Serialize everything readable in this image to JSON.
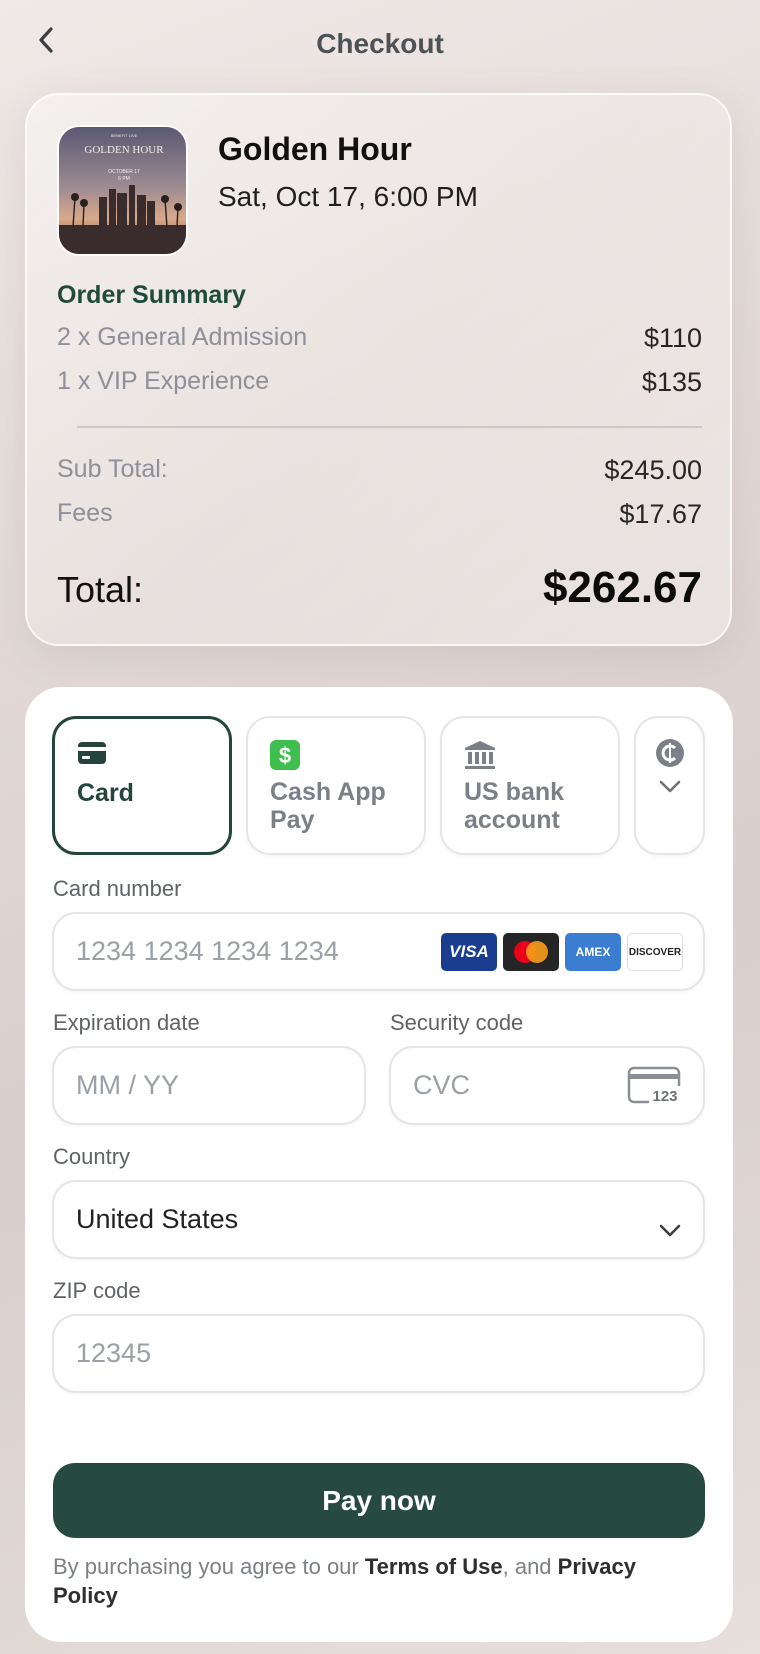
{
  "header": {
    "title": "Checkout"
  },
  "event": {
    "title": "Golden Hour",
    "datetime": "Sat, Oct 17, 6:00 PM",
    "thumbnail_text": {
      "top": "BENEFIT LIVE",
      "title": "GOLDEN HOUR",
      "date": "OCTOBER 17",
      "time": "6 PM"
    }
  },
  "order": {
    "heading": "Order Summary",
    "items": [
      {
        "label": "2 x General Admission",
        "price": "$110"
      },
      {
        "label": "1 x VIP Experience",
        "price": "$135"
      }
    ],
    "subtotal_label": "Sub Total:",
    "subtotal_value": "$245.00",
    "fees_label": "Fees",
    "fees_value": "$17.67",
    "total_label": "Total:",
    "total_value": "$262.67"
  },
  "payment": {
    "methods": [
      {
        "label": "Card",
        "icon": "credit-card-icon",
        "selected": true
      },
      {
        "label_line1": "Cash App",
        "label_line2": "Pay",
        "icon": "cash-app-icon"
      },
      {
        "label_line1": "US bank",
        "label_line2": "account",
        "icon": "bank-icon"
      },
      {
        "icon": "crypto-coin-icon"
      }
    ],
    "card_number": {
      "label": "Card number",
      "placeholder": "1234 1234 1234 1234"
    },
    "brands": [
      "VISA",
      "Mastercard",
      "AMEX",
      "DISCOVER"
    ],
    "expiration": {
      "label": "Expiration date",
      "placeholder": "MM / YY"
    },
    "security": {
      "label": "Security code",
      "placeholder": "CVC",
      "icon_text": "123"
    },
    "country": {
      "label": "Country",
      "value": "United States"
    },
    "zip": {
      "label": "ZIP code",
      "placeholder": "12345"
    },
    "pay_label": "Pay now",
    "legal": {
      "prefix": "By purchasing you agree to our ",
      "terms": "Terms of Use",
      "middle": ", and ",
      "privacy": "Privacy Policy"
    }
  },
  "colors": {
    "accent": "#274a40",
    "order_heading": "#1f4a3d",
    "cash_app_green": "#3fbe4f"
  }
}
